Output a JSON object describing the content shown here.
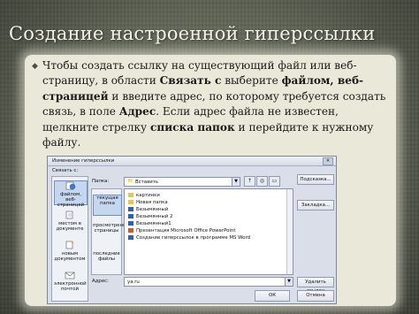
{
  "slide": {
    "title": "Создание настроенной гиперссылки",
    "paragraph": {
      "p1": "Чтобы создать ссылку на существующий файл или веб-страницу, в области ",
      "b1": "Связать с",
      "p2": " выберите ",
      "b2": "файлом, веб-страницей",
      "p3": " и введите адрес, по которому требуется создать связь, в поле ",
      "b3": "Адрес",
      "p4": ". Если адрес файла не известен, щелкните стрелку ",
      "b4": "списка папок",
      "p5": " и перейдите к нужному файлу."
    }
  },
  "dialog": {
    "title": "Изменение гиперссылки",
    "link_with_label": "Связать с:",
    "link_options": [
      "файлом, веб-страницей",
      "местом в документе",
      "новым документом",
      "электронной почтой"
    ],
    "folder_label": "Папка:",
    "folder_value": "Вставить",
    "view_options": [
      "текущая папка",
      "просмотренные страницы",
      "последние файлы"
    ],
    "files": [
      "картинки",
      "Новая папка",
      "Безымянный",
      "Безымянный 2",
      "Безымянный1",
      "Презентация Microsoft Office PowerPoint",
      "Создание гиперссылок в программе MS Word"
    ],
    "address_label": "Адрес:",
    "address_value": "ya.ru",
    "buttons": {
      "hint": "Подсказка...",
      "bookmark": "Закладка...",
      "remove": "Удалить ссылку",
      "ok": "ОК",
      "cancel": "Отмена"
    }
  }
}
